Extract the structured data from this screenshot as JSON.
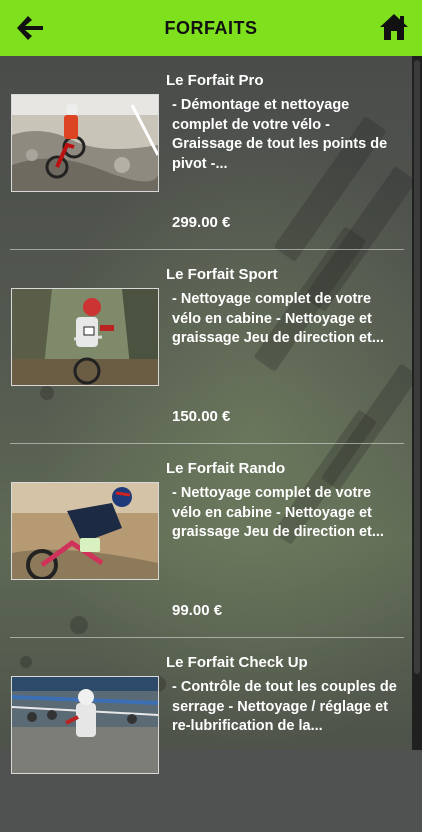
{
  "header": {
    "title": "FORFAITS",
    "back_icon": "arrow-left-icon",
    "home_icon": "home-icon",
    "color": "#7fe01d"
  },
  "packages": [
    {
      "name": "Le Forfait Pro",
      "description": "- Démontage et nettoyage complet de votre vélo - Graissage de tout les points de pivot -...",
      "price": "299.00 €"
    },
    {
      "name": "Le Forfait Sport",
      "description": "- Nettoyage complet de votre vélo en cabine - Nettoyage et graissage Jeu de direction et...",
      "price": "150.00 €"
    },
    {
      "name": "Le Forfait Rando",
      "description": "- Nettoyage complet de votre vélo en cabine - Nettoyage et graissage Jeu de direction et...",
      "price": "99.00 €"
    },
    {
      "name": "Le Forfait Check Up",
      "description": "- Contrôle de tout les couples de serrage - Nettoyage / réglage et re-lubrification de la...",
      "price": ""
    }
  ]
}
